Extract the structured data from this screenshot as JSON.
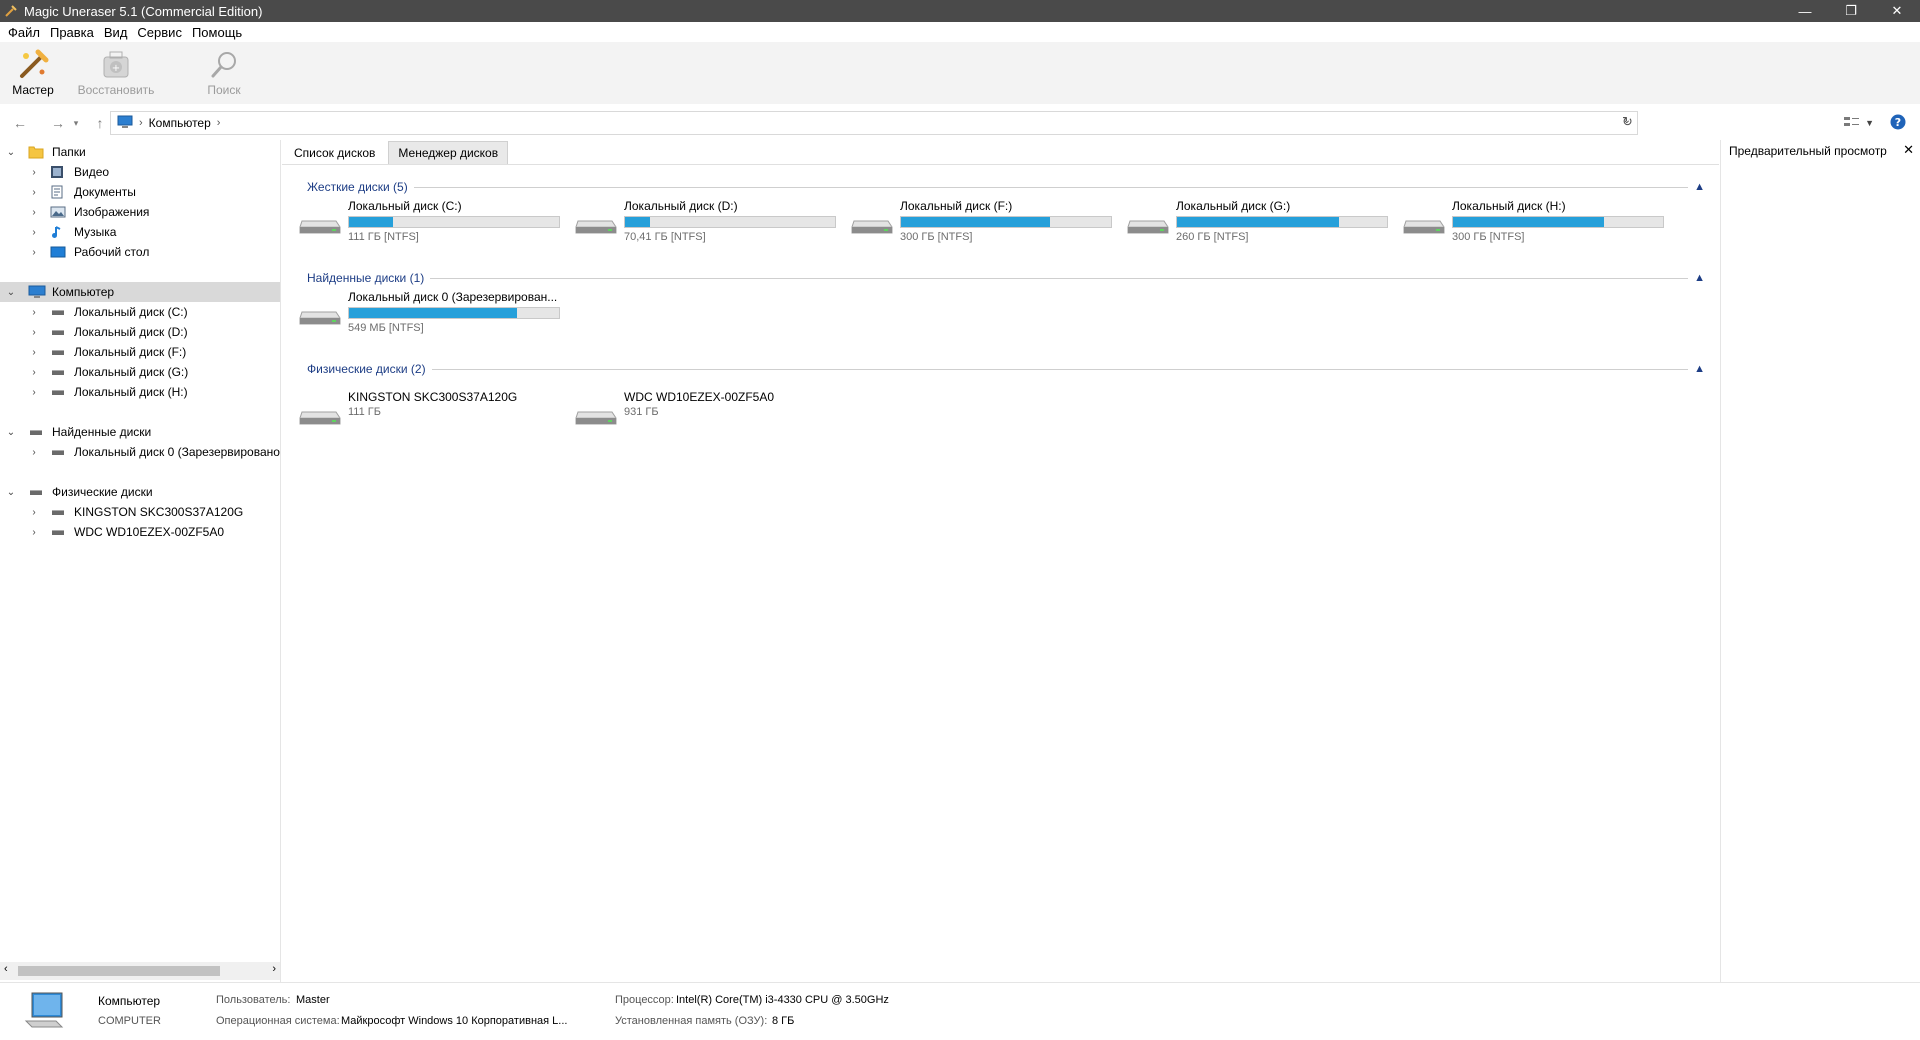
{
  "window": {
    "title": "Magic Uneraser 5.1 (Commercial Edition)",
    "minimize": "—",
    "maximize": "❐",
    "close": "✕"
  },
  "menu": [
    "Файл",
    "Правка",
    "Вид",
    "Сервис",
    "Помощь"
  ],
  "toolbar": {
    "wizard": "Мастер",
    "restore": "Восстановить",
    "search": "Поиск"
  },
  "address": {
    "path": "Компьютер"
  },
  "tree": {
    "folders": "Папки",
    "folder_items": [
      "Видео",
      "Документы",
      "Изображения",
      "Музыка",
      "Рабочий стол"
    ],
    "computer": "Компьютер",
    "computer_items": [
      "Локальный диск (C:)",
      "Локальный диск (D:)",
      "Локальный диск (F:)",
      "Локальный диск (G:)",
      "Локальный диск (H:)"
    ],
    "found": "Найденные диски",
    "found_items": [
      "Локальный диск 0 (Зарезервировано"
    ],
    "physical": "Физические диски",
    "physical_items": [
      "KINGSTON SKC300S37A120G",
      "WDC WD10EZEX-00ZF5A0"
    ]
  },
  "tabs": {
    "disk_list": "Список дисков",
    "disk_manager": "Менеджер дисков"
  },
  "sections": {
    "hard": "Жесткие диски (5)",
    "found": "Найденные диски (1)",
    "physical": "Физические диски (2)"
  },
  "hard_disks": [
    {
      "name": "Локальный диск (C:)",
      "info": "111 ГБ [NTFS]",
      "used": 0.21
    },
    {
      "name": "Локальный диск (D:)",
      "info": "70,41 ГБ [NTFS]",
      "used": 0.12
    },
    {
      "name": "Локальный диск (F:)",
      "info": "300 ГБ [NTFS]",
      "used": 0.71
    },
    {
      "name": "Локальный диск (G:)",
      "info": "260 ГБ [NTFS]",
      "used": 0.77
    },
    {
      "name": "Локальный диск (H:)",
      "info": "300 ГБ [NTFS]",
      "used": 0.72
    }
  ],
  "found_disks": [
    {
      "name": "Локальный диск 0 (Зарезервирован...",
      "info": "549 МБ [NTFS]",
      "used": 0.8
    }
  ],
  "physical_disks": [
    {
      "name": "KINGSTON SKC300S37A120G",
      "info": "111 ГБ"
    },
    {
      "name": "WDC WD10EZEX-00ZF5A0",
      "info": "931 ГБ"
    }
  ],
  "preview": {
    "title": "Предварительный просмотр"
  },
  "status": {
    "computer": "Компьютер",
    "computer_name": "COMPUTER",
    "user_label": "Пользователь:",
    "user": "Master",
    "os_label": "Операционная система:",
    "os": "Майкрософт Windows 10 Корпоративная L...",
    "cpu_label": "Процессор:",
    "cpu": "Intel(R) Core(TM) i3-4330 CPU @ 3.50GHz",
    "ram_label": "Установленная память (ОЗУ):",
    "ram": "8 ГБ"
  }
}
